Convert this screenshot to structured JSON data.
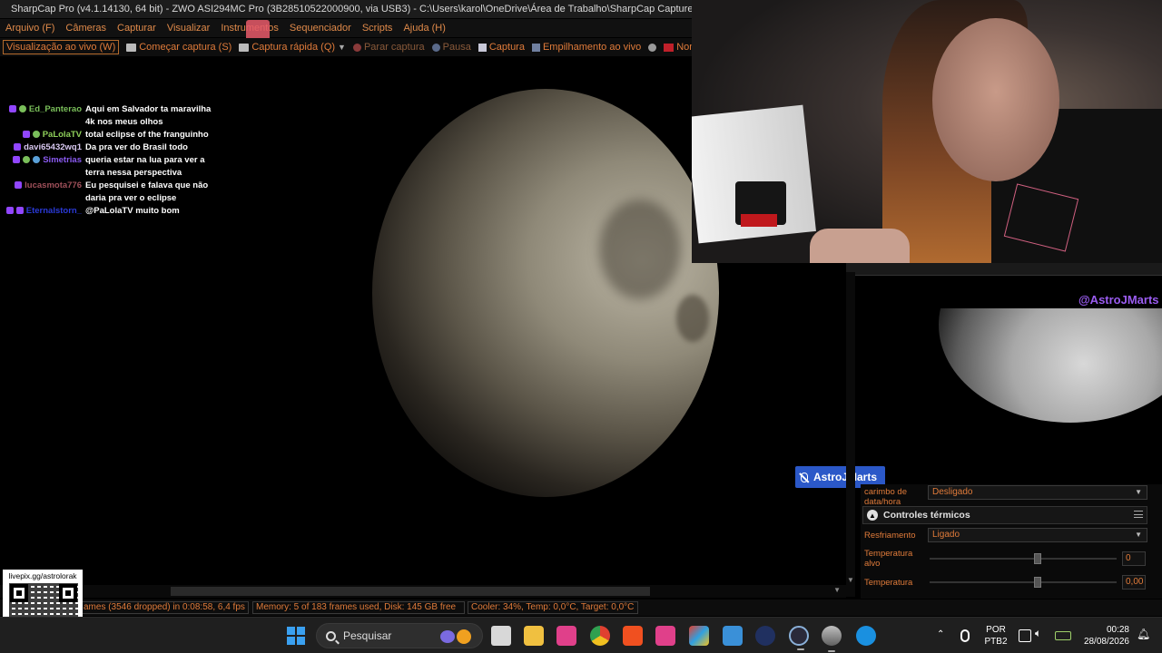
{
  "window": {
    "title": "SharpCap Pro (v4.1.14130, 64 bit) - ZWO ASI294MC Pro (3B28510522000900, via USB3) - C:\\Users\\karol\\OneDrive\\Área de Trabalho\\SharpCap Captures"
  },
  "menu": [
    "Arquivo (F)",
    "Câmeras",
    "Capturar",
    "Visualizar",
    "Instrumentos",
    "Sequenciador",
    "Scripts",
    "Ajuda (H)"
  ],
  "toolbar": {
    "live_view": "Visualização ao vivo (W)",
    "start_capture": "Começar captura (S)",
    "quick_capture": "Captura rápida (Q)",
    "stop_capture": "Parar captura",
    "pause": "Pausa",
    "snapshot": "Captura",
    "live_stack": "Empilhamento ao vivo",
    "target_name": "Nome de destino"
  },
  "chat": [
    {
      "user": "Ed_Panterao",
      "color": "#7abf5a",
      "text": "Aqui em Salvador ta maravilha 4k nos meus olhos"
    },
    {
      "user": "PaLolaTV",
      "color": "#8fd05a",
      "text": "total eclipse of the franguinho"
    },
    {
      "user": "davi65432wq1",
      "color": "#d8c8f0",
      "text": "Da pra ver do Brasil todo"
    },
    {
      "user": "Simetrias",
      "color": "#8a5af0",
      "text": "queria estar na lua para ver a terra nessa perspectiva"
    },
    {
      "user": "lucasmota776",
      "color": "#a0505a",
      "text": "Eu pesquisei e falava que não daria pra ver o eclipse"
    },
    {
      "user": "Eternalstorn_",
      "color": "#2a3ad8",
      "text": "@PaLolaTV muito bom"
    }
  ],
  "overlay": {
    "handle": "@AstroJMarts",
    "name_tag": "AstroJMarts"
  },
  "panel": {
    "row1_label": "carimbo de data/hora",
    "row1_value": "Desligado",
    "group_title": "Controles térmicos",
    "cooling_label": "Resfriamento",
    "cooling_value": "Ligado",
    "target_temp_label": "Temperatura alvo",
    "target_temp_value": "0",
    "temp_label": "Temperatura",
    "temp_value": "0,00",
    "target_temp_slider": 0.58,
    "temp_slider": 0.58
  },
  "status": {
    "frames": "ames (3546 dropped) in 0:08:58, 6,4 fps",
    "memory": "Memory: 5 of 183 frames used, Disk: 145 GB free",
    "cooler": "Cooler: 34%, Temp: 0,0°C, Target: 0,0°C"
  },
  "qr": {
    "label": "livepix.gg/astrolorak"
  },
  "taskbar": {
    "search_placeholder": "Pesquisar",
    "lang_line1": "POR",
    "lang_line2": "PTB2",
    "time": "00:28",
    "date": "28/08/2026"
  },
  "colors": {
    "accent_orange": "#e07b3a",
    "handle_purple": "#9a5cf0",
    "name_tag_blue": "#2b58c8"
  }
}
